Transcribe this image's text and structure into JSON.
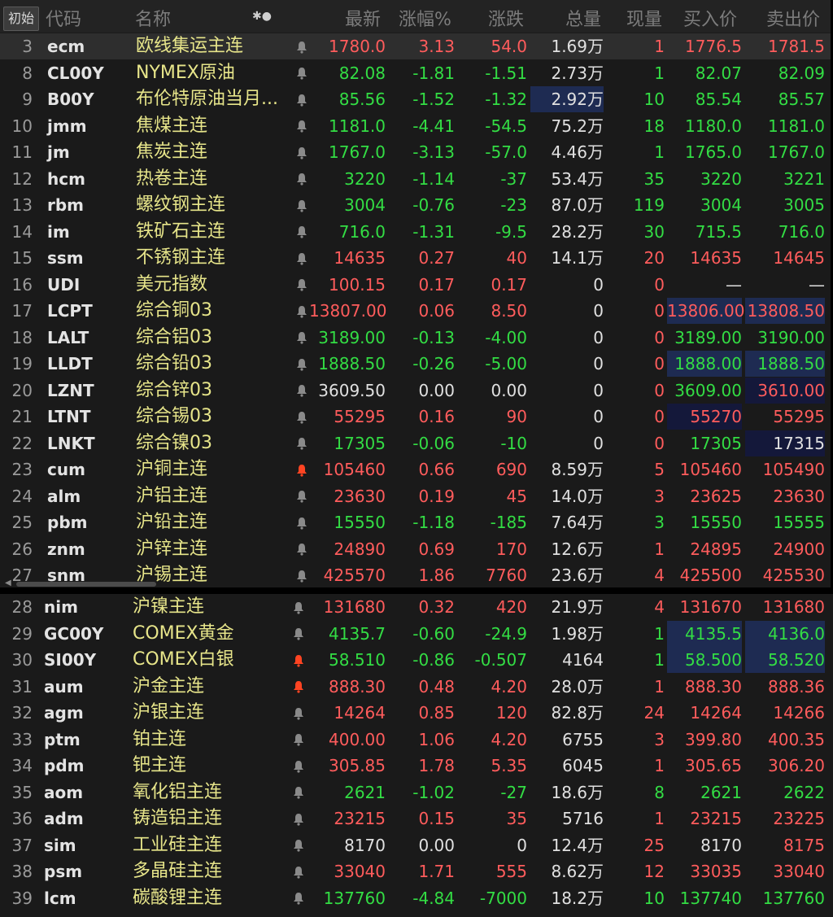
{
  "header": {
    "init_label": "初始",
    "cols": [
      "代码",
      "名称",
      "最新",
      "涨幅%",
      "涨跌",
      "总量",
      "现量",
      "买入价",
      "卖出价"
    ],
    "dots": "✱●"
  },
  "colors": {
    "up": "#ff5c5c",
    "down": "#33dd44",
    "name": "#e7e58a",
    "alert_bell": "#ff4422"
  },
  "rows_top": [
    {
      "idx": "3",
      "code": "ecm",
      "name": "欧线集运主连",
      "last": "1780.0",
      "pct": "3.13",
      "chg": "54.0",
      "vol": "1.69万",
      "cur": "1",
      "bid": "1776.5",
      "ask": "1781.5",
      "dir": "up",
      "bell": "gray",
      "bid_dir": "up",
      "ask_dir": "up"
    },
    {
      "idx": "8",
      "code": "CL00Y",
      "name": "NYMEX原油",
      "last": "82.08",
      "pct": "-1.81",
      "chg": "-1.51",
      "vol": "2.73万",
      "cur": "1",
      "bid": "82.07",
      "ask": "82.09",
      "dir": "down",
      "bell": "gray",
      "bid_dir": "down",
      "ask_dir": "down"
    },
    {
      "idx": "9",
      "code": "B00Y",
      "name": "布伦特原油当月...",
      "last": "85.56",
      "pct": "-1.52",
      "chg": "-1.32",
      "vol": "2.92万",
      "cur": "10",
      "bid": "85.54",
      "ask": "85.57",
      "dir": "down",
      "bell": "gray",
      "bid_dir": "down",
      "ask_dir": "down",
      "vol_hl": true
    },
    {
      "idx": "10",
      "code": "jmm",
      "name": "焦煤主连",
      "last": "1181.0",
      "pct": "-4.41",
      "chg": "-54.5",
      "vol": "75.2万",
      "cur": "18",
      "bid": "1180.0",
      "ask": "1181.0",
      "dir": "down",
      "bell": "gray",
      "bid_dir": "down",
      "ask_dir": "down"
    },
    {
      "idx": "11",
      "code": "jm",
      "name": "焦炭主连",
      "last": "1767.0",
      "pct": "-3.13",
      "chg": "-57.0",
      "vol": "4.46万",
      "cur": "1",
      "bid": "1765.0",
      "ask": "1767.0",
      "dir": "down",
      "bell": "gray",
      "bid_dir": "down",
      "ask_dir": "down"
    },
    {
      "idx": "12",
      "code": "hcm",
      "name": "热卷主连",
      "last": "3220",
      "pct": "-1.14",
      "chg": "-37",
      "vol": "53.4万",
      "cur": "35",
      "bid": "3220",
      "ask": "3221",
      "dir": "down",
      "bell": "gray",
      "bid_dir": "down",
      "ask_dir": "down"
    },
    {
      "idx": "13",
      "code": "rbm",
      "name": "螺纹钢主连",
      "last": "3004",
      "pct": "-0.76",
      "chg": "-23",
      "vol": "87.0万",
      "cur": "119",
      "bid": "3004",
      "ask": "3005",
      "dir": "down",
      "bell": "gray",
      "bid_dir": "down",
      "ask_dir": "down"
    },
    {
      "idx": "14",
      "code": "im",
      "name": "铁矿石主连",
      "last": "716.0",
      "pct": "-1.31",
      "chg": "-9.5",
      "vol": "28.2万",
      "cur": "30",
      "bid": "715.5",
      "ask": "716.0",
      "dir": "down",
      "bell": "gray",
      "bid_dir": "down",
      "ask_dir": "down"
    },
    {
      "idx": "15",
      "code": "ssm",
      "name": "不锈钢主连",
      "last": "14635",
      "pct": "0.27",
      "chg": "40",
      "vol": "14.1万",
      "cur": "20",
      "bid": "14635",
      "ask": "14645",
      "dir": "up",
      "bell": "gray",
      "bid_dir": "up",
      "ask_dir": "up"
    },
    {
      "idx": "16",
      "code": "UDI",
      "name": "美元指数",
      "last": "100.15",
      "pct": "0.17",
      "chg": "0.17",
      "vol": "0",
      "cur": "0",
      "bid": "—",
      "ask": "—",
      "dir": "up",
      "bell": "gray",
      "bid_dir": "flat",
      "ask_dir": "flat"
    },
    {
      "idx": "17",
      "code": "LCPT",
      "name": "综合铜03",
      "last": "13807.00",
      "pct": "0.06",
      "chg": "8.50",
      "vol": "0",
      "cur": "0",
      "bid": "13806.00",
      "ask": "13808.50",
      "dir": "up",
      "bell": "gray",
      "bid_dir": "up",
      "ask_dir": "up",
      "bid_hl": "hl",
      "ask_hl": "hl"
    },
    {
      "idx": "18",
      "code": "LALT",
      "name": "综合铝03",
      "last": "3189.00",
      "pct": "-0.13",
      "chg": "-4.00",
      "vol": "0",
      "cur": "0",
      "bid": "3189.00",
      "ask": "3190.00",
      "dir": "down",
      "bell": "gray",
      "bid_dir": "down",
      "ask_dir": "down"
    },
    {
      "idx": "19",
      "code": "LLDT",
      "name": "综合铅03",
      "last": "1888.50",
      "pct": "-0.26",
      "chg": "-5.00",
      "vol": "0",
      "cur": "0",
      "bid": "1888.00",
      "ask": "1888.50",
      "dir": "down",
      "bell": "gray",
      "bid_dir": "down",
      "ask_dir": "down",
      "bid_hl": "hl",
      "ask_hl": "hl"
    },
    {
      "idx": "20",
      "code": "LZNT",
      "name": "综合锌03",
      "last": "3609.50",
      "pct": "0.00",
      "chg": "0.00",
      "vol": "0",
      "cur": "0",
      "bid": "3609.00",
      "ask": "3610.00",
      "dir": "flat",
      "bell": "gray",
      "bid_dir": "down",
      "ask_dir": "up",
      "ask_hl": "hl2"
    },
    {
      "idx": "21",
      "code": "LTNT",
      "name": "综合锡03",
      "last": "55295",
      "pct": "0.16",
      "chg": "90",
      "vol": "0",
      "cur": "0",
      "bid": "55270",
      "ask": "55295",
      "dir": "up",
      "bell": "gray",
      "bid_dir": "up",
      "ask_dir": "up",
      "bid_hl": "hl2"
    },
    {
      "idx": "22",
      "code": "LNKT",
      "name": "综合镍03",
      "last": "17305",
      "pct": "-0.06",
      "chg": "-10",
      "vol": "0",
      "cur": "0",
      "bid": "17305",
      "ask": "17315",
      "dir": "down",
      "bell": "gray",
      "bid_dir": "down",
      "ask_dir": "flat",
      "ask_hl": "hl2"
    },
    {
      "idx": "23",
      "code": "cum",
      "name": "沪铜主连",
      "last": "105460",
      "pct": "0.66",
      "chg": "690",
      "vol": "8.59万",
      "cur": "5",
      "bid": "105460",
      "ask": "105490",
      "dir": "up",
      "bell": "red",
      "bid_dir": "up",
      "ask_dir": "up"
    },
    {
      "idx": "24",
      "code": "alm",
      "name": "沪铝主连",
      "last": "23630",
      "pct": "0.19",
      "chg": "45",
      "vol": "14.0万",
      "cur": "3",
      "bid": "23625",
      "ask": "23630",
      "dir": "up",
      "bell": "gray",
      "bid_dir": "up",
      "ask_dir": "up"
    },
    {
      "idx": "25",
      "code": "pbm",
      "name": "沪铅主连",
      "last": "15550",
      "pct": "-1.18",
      "chg": "-185",
      "vol": "7.64万",
      "cur": "3",
      "bid": "15550",
      "ask": "15555",
      "dir": "down",
      "bell": "gray",
      "bid_dir": "down",
      "ask_dir": "down"
    },
    {
      "idx": "26",
      "code": "znm",
      "name": "沪锌主连",
      "last": "24890",
      "pct": "0.69",
      "chg": "170",
      "vol": "12.6万",
      "cur": "1",
      "bid": "24895",
      "ask": "24900",
      "dir": "up",
      "bell": "gray",
      "bid_dir": "up",
      "ask_dir": "up"
    },
    {
      "idx": "27",
      "code": "snm",
      "name": "沪锡主连",
      "last": "425570",
      "pct": "1.86",
      "chg": "7760",
      "vol": "23.6万",
      "cur": "4",
      "bid": "425500",
      "ask": "425530",
      "dir": "up",
      "bell": "gray",
      "bid_dir": "up",
      "ask_dir": "up"
    }
  ],
  "rows_bottom": [
    {
      "idx": "28",
      "code": "nim",
      "name": "沪镍主连",
      "last": "131680",
      "pct": "0.32",
      "chg": "420",
      "vol": "21.9万",
      "cur": "4",
      "bid": "131670",
      "ask": "131680",
      "dir": "up",
      "bell": "gray",
      "bid_dir": "up",
      "ask_dir": "up"
    },
    {
      "idx": "29",
      "code": "GC00Y",
      "name": "COMEX黄金",
      "last": "4135.7",
      "pct": "-0.60",
      "chg": "-24.9",
      "vol": "1.98万",
      "cur": "1",
      "bid": "4135.5",
      "ask": "4136.0",
      "dir": "down",
      "bell": "gray",
      "bid_dir": "down",
      "ask_dir": "down",
      "bid_hl": "hl",
      "ask_hl": "hl"
    },
    {
      "idx": "30",
      "code": "SI00Y",
      "name": "COMEX白银",
      "last": "58.510",
      "pct": "-0.86",
      "chg": "-0.507",
      "vol": "4164",
      "cur": "1",
      "bid": "58.500",
      "ask": "58.520",
      "dir": "down",
      "bell": "red",
      "bid_dir": "down",
      "ask_dir": "down",
      "bid_hl": "hl",
      "ask_hl": "hl"
    },
    {
      "idx": "31",
      "code": "aum",
      "name": "沪金主连",
      "last": "888.30",
      "pct": "0.48",
      "chg": "4.20",
      "vol": "28.0万",
      "cur": "1",
      "bid": "888.30",
      "ask": "888.36",
      "dir": "up",
      "bell": "red",
      "bid_dir": "up",
      "ask_dir": "up"
    },
    {
      "idx": "32",
      "code": "agm",
      "name": "沪银主连",
      "last": "14264",
      "pct": "0.85",
      "chg": "120",
      "vol": "82.8万",
      "cur": "24",
      "bid": "14264",
      "ask": "14266",
      "dir": "up",
      "bell": "gray",
      "bid_dir": "up",
      "ask_dir": "up"
    },
    {
      "idx": "33",
      "code": "ptm",
      "name": "铂主连",
      "last": "400.00",
      "pct": "1.06",
      "chg": "4.20",
      "vol": "6755",
      "cur": "3",
      "bid": "399.80",
      "ask": "400.35",
      "dir": "up",
      "bell": "gray",
      "bid_dir": "up",
      "ask_dir": "up"
    },
    {
      "idx": "34",
      "code": "pdm",
      "name": "钯主连",
      "last": "305.85",
      "pct": "1.78",
      "chg": "5.35",
      "vol": "6045",
      "cur": "1",
      "bid": "305.65",
      "ask": "306.20",
      "dir": "up",
      "bell": "gray",
      "bid_dir": "up",
      "ask_dir": "up"
    },
    {
      "idx": "35",
      "code": "aom",
      "name": "氧化铝主连",
      "last": "2621",
      "pct": "-1.02",
      "chg": "-27",
      "vol": "18.6万",
      "cur": "8",
      "bid": "2621",
      "ask": "2622",
      "dir": "down",
      "bell": "gray",
      "bid_dir": "down",
      "ask_dir": "down"
    },
    {
      "idx": "36",
      "code": "adm",
      "name": "铸造铝主连",
      "last": "23215",
      "pct": "0.15",
      "chg": "35",
      "vol": "5716",
      "cur": "1",
      "bid": "23215",
      "ask": "23225",
      "dir": "up",
      "bell": "gray",
      "bid_dir": "up",
      "ask_dir": "up"
    },
    {
      "idx": "37",
      "code": "sim",
      "name": "工业硅主连",
      "last": "8170",
      "pct": "0.00",
      "chg": "0",
      "vol": "12.4万",
      "cur": "25",
      "bid": "8170",
      "ask": "8175",
      "dir": "flat",
      "bell": "gray",
      "bid_dir": "flat",
      "ask_dir": "up"
    },
    {
      "idx": "38",
      "code": "psm",
      "name": "多晶硅主连",
      "last": "33040",
      "pct": "1.71",
      "chg": "555",
      "vol": "8.62万",
      "cur": "12",
      "bid": "33035",
      "ask": "33040",
      "dir": "up",
      "bell": "gray",
      "bid_dir": "up",
      "ask_dir": "up"
    },
    {
      "idx": "39",
      "code": "lcm",
      "name": "碳酸锂主连",
      "last": "137760",
      "pct": "-4.84",
      "chg": "-7000",
      "vol": "18.2万",
      "cur": "10",
      "bid": "137740",
      "ask": "137760",
      "dir": "down",
      "bell": "gray",
      "bid_dir": "down",
      "ask_dir": "down"
    }
  ]
}
